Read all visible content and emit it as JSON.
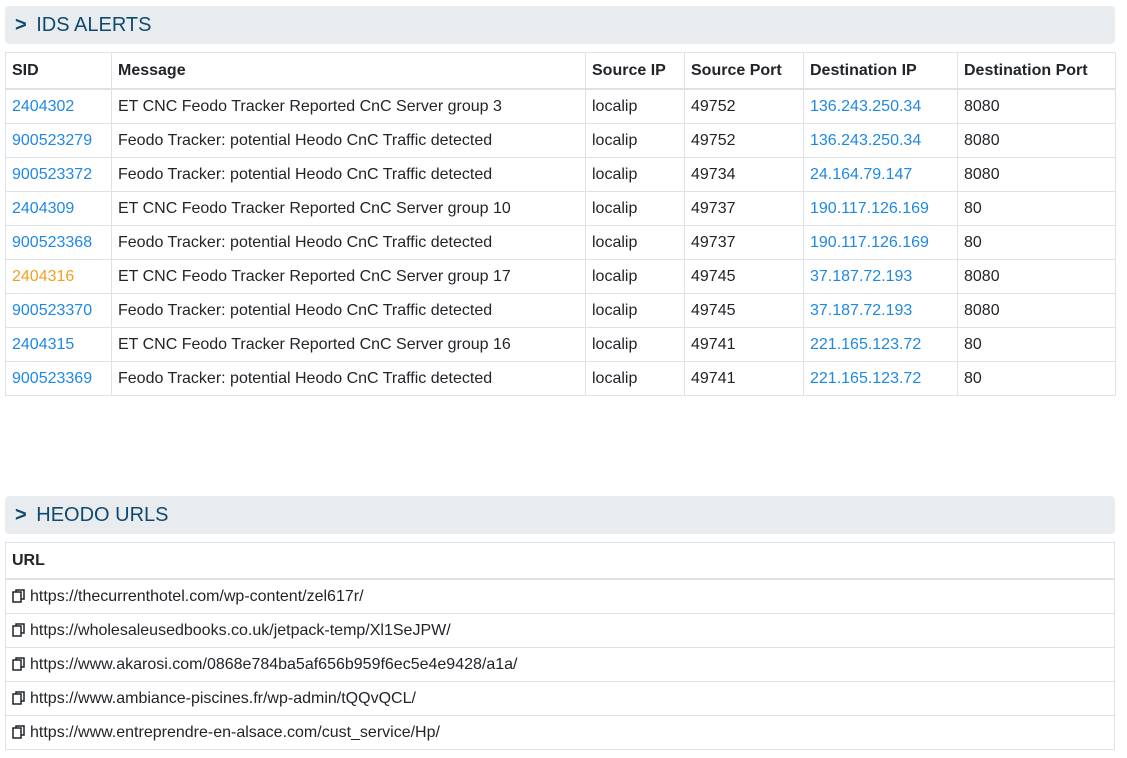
{
  "ids_section": {
    "caret": ">",
    "title": "IDS ALERTS",
    "columns": [
      "SID",
      "Message",
      "Source IP",
      "Source Port",
      "Destination IP",
      "Destination Port"
    ],
    "rows": [
      {
        "sid": "2404302",
        "sid_style": "link",
        "message": "ET CNC Feodo Tracker Reported CnC Server group 3",
        "src_ip": "localip",
        "src_port": "49752",
        "dst_ip": "136.243.250.34",
        "dst_port": "8080"
      },
      {
        "sid": "900523279",
        "sid_style": "link",
        "message": "Feodo Tracker: potential Heodo CnC Traffic detected",
        "src_ip": "localip",
        "src_port": "49752",
        "dst_ip": "136.243.250.34",
        "dst_port": "8080"
      },
      {
        "sid": "900523372",
        "sid_style": "link",
        "message": "Feodo Tracker: potential Heodo CnC Traffic detected",
        "src_ip": "localip",
        "src_port": "49734",
        "dst_ip": "24.164.79.147",
        "dst_port": "8080"
      },
      {
        "sid": "2404309",
        "sid_style": "link",
        "message": "ET CNC Feodo Tracker Reported CnC Server group 10",
        "src_ip": "localip",
        "src_port": "49737",
        "dst_ip": "190.117.126.169",
        "dst_port": "80"
      },
      {
        "sid": "900523368",
        "sid_style": "link",
        "message": "Feodo Tracker: potential Heodo CnC Traffic detected",
        "src_ip": "localip",
        "src_port": "49737",
        "dst_ip": "190.117.126.169",
        "dst_port": "80"
      },
      {
        "sid": "2404316",
        "sid_style": "warn",
        "message": "ET CNC Feodo Tracker Reported CnC Server group 17",
        "src_ip": "localip",
        "src_port": "49745",
        "dst_ip": "37.187.72.193",
        "dst_port": "8080"
      },
      {
        "sid": "900523370",
        "sid_style": "link",
        "message": "Feodo Tracker: potential Heodo CnC Traffic detected",
        "src_ip": "localip",
        "src_port": "49745",
        "dst_ip": "37.187.72.193",
        "dst_port": "8080"
      },
      {
        "sid": "2404315",
        "sid_style": "link",
        "message": "ET CNC Feodo Tracker Reported CnC Server group 16",
        "src_ip": "localip",
        "src_port": "49741",
        "dst_ip": "221.165.123.72",
        "dst_port": "80"
      },
      {
        "sid": "900523369",
        "sid_style": "link",
        "message": "Feodo Tracker: potential Heodo CnC Traffic detected",
        "src_ip": "localip",
        "src_port": "49741",
        "dst_ip": "221.165.123.72",
        "dst_port": "80"
      }
    ]
  },
  "heodo_section": {
    "caret": ">",
    "title": "HEODO URLS",
    "column": "URL",
    "urls": [
      "https://thecurrenthotel.com/wp-content/zel617r/",
      "https://wholesaleusedbooks.co.uk/jetpack-temp/Xl1SeJPW/",
      "https://www.akarosi.com/0868e784ba5af656b959f6ec5e4e9428/a1a/",
      "https://www.ambiance-piscines.fr/wp-admin/tQQvQCL/",
      "https://www.entreprendre-en-alsace.com/cust_service/Hp/"
    ],
    "row_icon": "copy-icon"
  },
  "colors": {
    "header_bg": "#e9ecef",
    "header_text": "#0f4a6e",
    "link": "#1e88e5",
    "warning_sid": "#f0a020",
    "border": "#dee2e6"
  }
}
